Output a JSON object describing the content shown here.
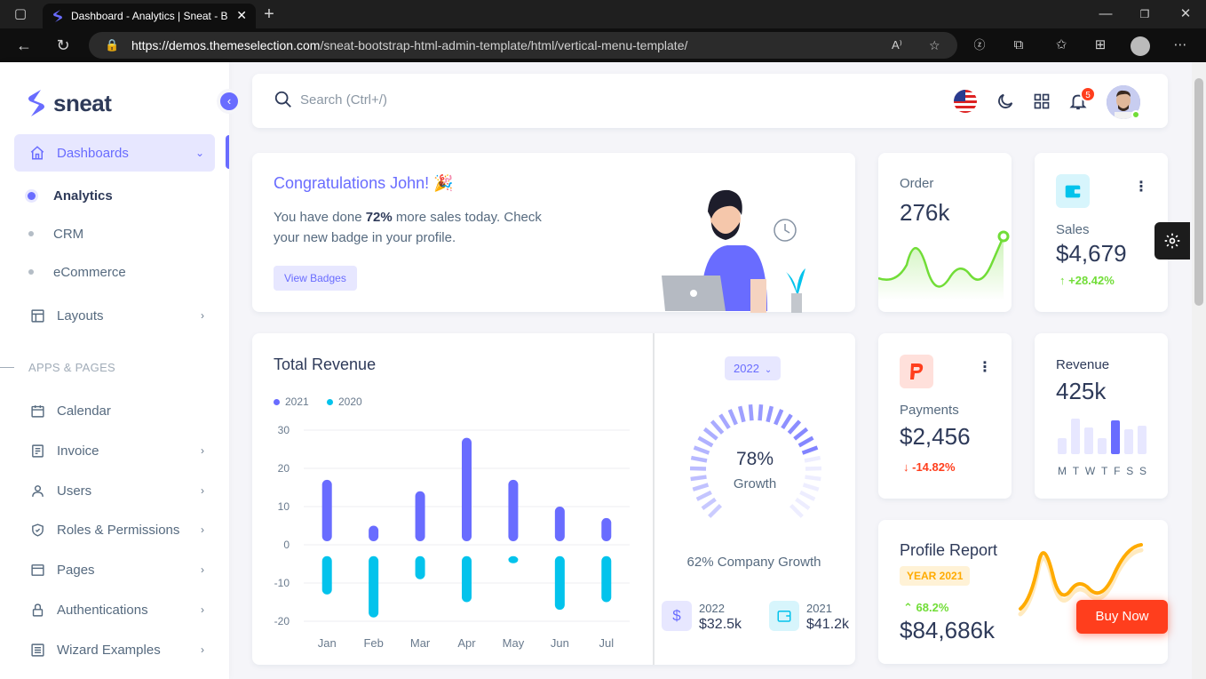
{
  "browser": {
    "tab_title": "Dashboard - Analytics | Sneat - B",
    "url_domain": "https://demos.themeselection.com",
    "url_path": "/sneat-bootstrap-html-admin-template/html/vertical-menu-template/"
  },
  "sidebar": {
    "brand": "sneat",
    "dashboards": "Dashboards",
    "sub": [
      "Analytics",
      "CRM",
      "eCommerce"
    ],
    "layouts": "Layouts",
    "section": "APPS & PAGES",
    "apps": [
      "Calendar",
      "Invoice",
      "Users",
      "Roles & Permissions",
      "Pages",
      "Authentications",
      "Wizard Examples"
    ]
  },
  "navbar": {
    "search_placeholder": "Search (Ctrl+/)",
    "notifications": "5"
  },
  "welcome": {
    "title": "Congratulations John! 🎉",
    "line1_a": "You have done ",
    "line1_b": "72%",
    "line1_c": " more sales today. Check",
    "line2": "your new badge in your profile.",
    "button": "View Badges"
  },
  "order": {
    "label": "Order",
    "value": "276k"
  },
  "sales": {
    "label": "Sales",
    "value": "$4,679",
    "change": "+28.42%"
  },
  "revenue_chart": {
    "title": "Total Revenue"
  },
  "growth": {
    "year_button": "2022",
    "percent": "78%",
    "label": "Growth",
    "company": "62% Company Growth",
    "y1": "2022",
    "v1": "$32.5k",
    "y2": "2021",
    "v2": "$41.2k"
  },
  "payments": {
    "label": "Payments",
    "value": "$2,456",
    "change": "-14.82%"
  },
  "revenue_card": {
    "label": "Revenue",
    "value": "425k",
    "days": [
      "M",
      "T",
      "W",
      "T",
      "F",
      "S",
      "S"
    ]
  },
  "profile": {
    "title": "Profile Report",
    "badge": "YEAR 2021",
    "change": "68.2%",
    "value": "$84,686k"
  },
  "buy_now": "Buy Now",
  "colors": {
    "primary": "#696cff",
    "info": "#03c3ec",
    "success": "#71dd37",
    "danger": "#ff3e1d",
    "warning": "#ffab00"
  },
  "chart_data": {
    "type": "bar",
    "title": "Total Revenue",
    "categories": [
      "Jan",
      "Feb",
      "Mar",
      "Apr",
      "May",
      "Jun",
      "Jul"
    ],
    "series": [
      {
        "name": "2021",
        "values": [
          17,
          5,
          14,
          28,
          17,
          10,
          7
        ]
      },
      {
        "name": "2020",
        "values": [
          -13,
          -19,
          -9,
          -15,
          -4,
          -17,
          -15
        ]
      }
    ],
    "yticks": [
      "30",
      "20",
      "10",
      "0",
      "-10",
      "-20"
    ],
    "ylim": [
      -20,
      30
    ],
    "grid": true,
    "legend": "top-left"
  }
}
